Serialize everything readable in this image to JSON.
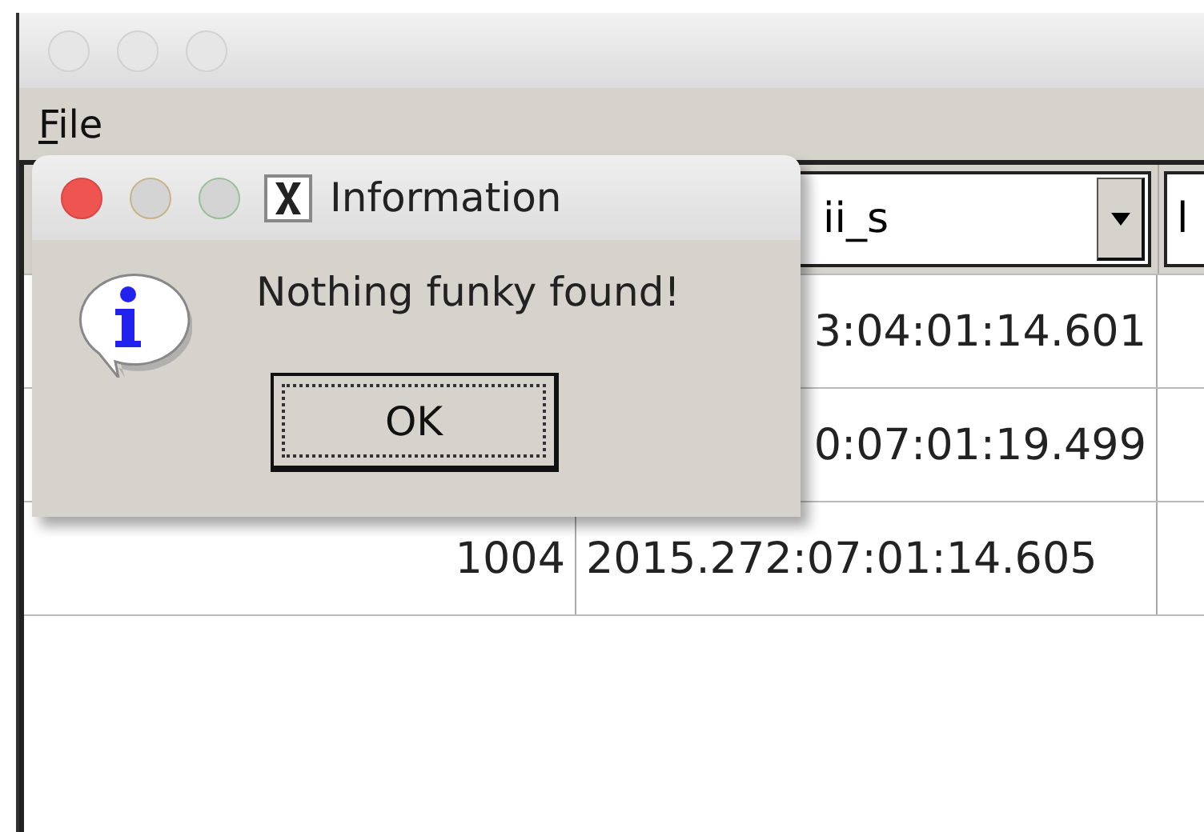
{
  "window": {
    "menu": [
      "File"
    ]
  },
  "table": {
    "headers": [
      {
        "text": "ii_s"
      },
      {
        "text": "l"
      }
    ],
    "rows": [
      {
        "column_2": "3:04:01:14.601"
      },
      {
        "column_2": "0:07:01:19.499"
      },
      {
        "column_1": "1004",
        "column_2": "2015.272:07:01:14.605"
      }
    ]
  },
  "dialog": {
    "title": "Information",
    "message": "Nothing funky found!",
    "button": "OK"
  }
}
